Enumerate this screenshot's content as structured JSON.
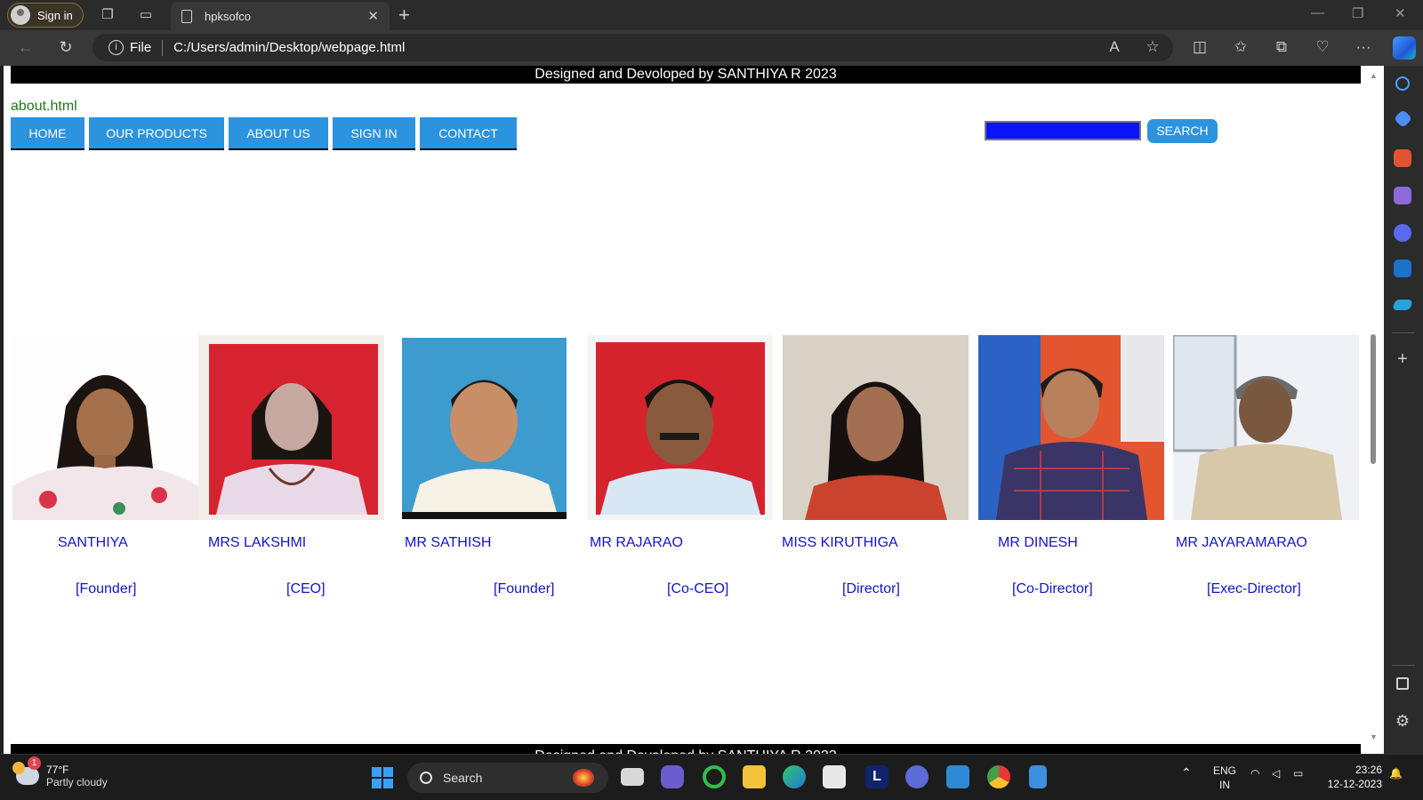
{
  "browser": {
    "signin_label": "Sign in",
    "tab_title": "hpksofco",
    "file_label": "File",
    "url": "C:/Users/admin/Desktop/webpage.html"
  },
  "page": {
    "banner_text": "Designed and Devoloped by SANTHIYA R 2023",
    "about_link": "about.html",
    "menu": [
      "HOME",
      "OUR PRODUCTS",
      "ABOUT US",
      "SIGN IN",
      "CONTACT"
    ],
    "search_button": "SEARCH",
    "team": [
      {
        "name": "SANTHIYA",
        "role": "[Founder]"
      },
      {
        "name": "MRS LAKSHMI",
        "role": "[CEO]"
      },
      {
        "name": "MR SATHISH",
        "role": "[Founder]"
      },
      {
        "name": "MR RAJARAO",
        "role": "[Co-CEO]"
      },
      {
        "name": "MISS KIRUTHIGA",
        "role": "[Director]"
      },
      {
        "name": "MR DINESH",
        "role": "[Co-Director]"
      },
      {
        "name": "MR JAYARAMARAO",
        "role": "[Exec-Director]"
      }
    ]
  },
  "taskbar": {
    "weather_temp": "77°F",
    "weather_desc": "Partly cloudy",
    "weather_badge": "1",
    "search_label": "Search",
    "lang_top": "ENG",
    "lang_bottom": "IN",
    "time": "23:26",
    "date": "12-12-2023"
  },
  "colors": {
    "menu_button": "#2c93df",
    "search_input": "#0a13ff",
    "team_text": "#1414c8",
    "about_link": "#1b7a1b"
  }
}
